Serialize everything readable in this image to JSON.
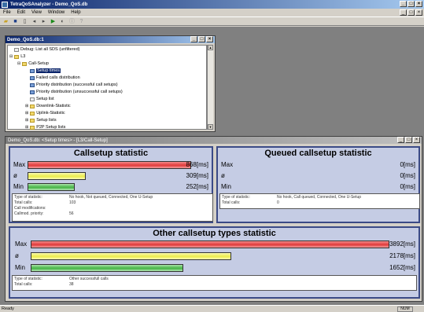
{
  "app": {
    "title": "TetraQoSAnalyzer - Demo_QoS.db"
  },
  "window_buttons": {
    "min": "_",
    "max": "□",
    "close": "×"
  },
  "menu": [
    "File",
    "Edit",
    "View",
    "Window",
    "Help"
  ],
  "child_top": {
    "title": "Demo_QoS.db:1",
    "tree": [
      {
        "label": "Debug: List all SDS (unfiltered)",
        "icon": "doc-icon"
      },
      {
        "label": "L3",
        "icon": "folder-icon"
      },
      {
        "label": "Call-Setup",
        "icon": "folder-icon"
      },
      {
        "label": "Setup times",
        "icon": "chart-icon",
        "selected": true
      },
      {
        "label": "Failed calls distribution",
        "icon": "chart-icon"
      },
      {
        "label": "Priority distribution (successful call setups)",
        "icon": "chart-icon"
      },
      {
        "label": "Priority distribution (unsuccessful call setups)",
        "icon": "chart-icon"
      },
      {
        "label": "Setup list",
        "icon": "doc-icon"
      },
      {
        "label": "Downlink-Statistic",
        "icon": "folder-icon"
      },
      {
        "label": "Uplink-Statistic",
        "icon": "folder-icon"
      },
      {
        "label": "Setup lists",
        "icon": "folder-icon"
      },
      {
        "label": "P2P Setup lists",
        "icon": "folder-icon"
      }
    ]
  },
  "child_bottom": {
    "title": "Demo_QoS.db: <Setup times> - [L3/Call-Setup]"
  },
  "callsetup": {
    "title": "Callsetup statistic",
    "rows": [
      {
        "label": "Max",
        "value": "868[ms]",
        "fraction": 1.0,
        "color": "red"
      },
      {
        "label": "ø",
        "value": "309[ms]",
        "fraction": 0.356,
        "color": "yellow"
      },
      {
        "label": "Min",
        "value": "252[ms]",
        "fraction": 0.29,
        "color": "green"
      }
    ],
    "info": [
      {
        "k": "Type of statistic:",
        "v": "No hook, Not queued, Connected, One U-Setup"
      },
      {
        "k": "Total calls:",
        "v": "103"
      },
      {
        "k": "Call modifications:",
        "v": ""
      },
      {
        "k": "Callmod. priority:",
        "v": "56"
      }
    ]
  },
  "queued": {
    "title": "Queued callsetup statistic",
    "rows": [
      {
        "label": "Max",
        "value": "0[ms]"
      },
      {
        "label": "ø",
        "value": "0[ms]"
      },
      {
        "label": "Min",
        "value": "0[ms]"
      }
    ],
    "info": [
      {
        "k": "Type of statistic:",
        "v": "No hook, Call queued, Connected, One U-Setup"
      },
      {
        "k": "Total calls:",
        "v": "0"
      }
    ]
  },
  "other": {
    "title": "Other callsetup types statistic",
    "rows": [
      {
        "label": "Max",
        "value": "3892[ms]",
        "fraction": 1.0,
        "color": "red"
      },
      {
        "label": "ø",
        "value": "2178[ms]",
        "fraction": 0.56,
        "color": "yellow"
      },
      {
        "label": "Min",
        "value": "1652[ms]",
        "fraction": 0.4245,
        "color": "green"
      }
    ],
    "info": [
      {
        "k": "Type of statistic:",
        "v": "Other successfull calls"
      },
      {
        "k": "Total calls:",
        "v": "38"
      }
    ]
  },
  "status": {
    "text": "Ready",
    "num": "NUM"
  }
}
